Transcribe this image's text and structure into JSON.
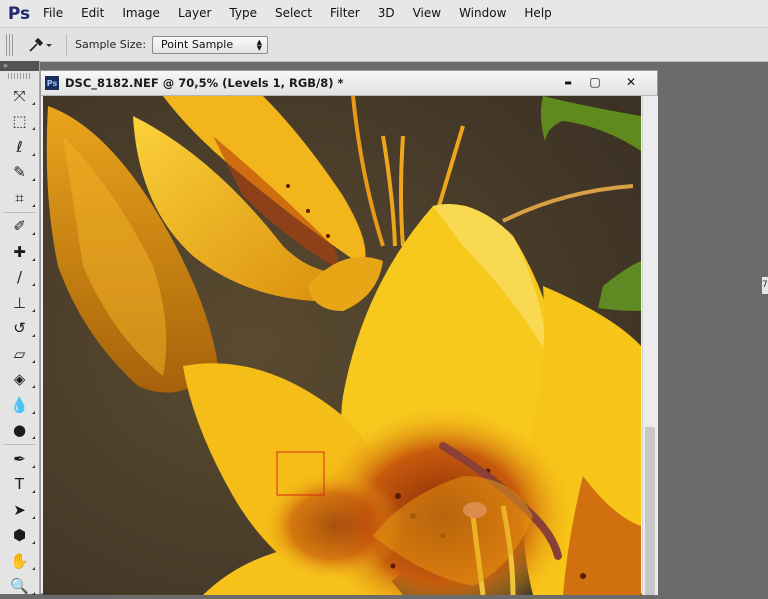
{
  "app": {
    "logo": "Ps"
  },
  "menu": [
    "File",
    "Edit",
    "Image",
    "Layer",
    "Type",
    "Select",
    "Filter",
    "3D",
    "View",
    "Window",
    "Help"
  ],
  "options_bar": {
    "sample_size_label": "Sample Size:",
    "sample_size_value": "Point Sample"
  },
  "tools_panel": {
    "header": "»",
    "tools": [
      {
        "name": "move-tool-icon",
        "glyph": "⤧"
      },
      {
        "name": "marquee-tool-icon",
        "glyph": "⬚"
      },
      {
        "name": "lasso-tool-icon",
        "glyph": "ℓ"
      },
      {
        "name": "quick-selection-tool-icon",
        "glyph": "✎"
      },
      {
        "name": "crop-tool-icon",
        "glyph": "⌗"
      },
      {
        "name": "eyedropper-tool-icon",
        "glyph": "✐"
      },
      {
        "name": "healing-brush-tool-icon",
        "glyph": "✚"
      },
      {
        "name": "brush-tool-icon",
        "glyph": "/"
      },
      {
        "name": "clone-stamp-tool-icon",
        "glyph": "⊥"
      },
      {
        "name": "history-brush-tool-icon",
        "glyph": "↺"
      },
      {
        "name": "eraser-tool-icon",
        "glyph": "▱"
      },
      {
        "name": "paint-bucket-tool-icon",
        "glyph": "◈"
      },
      {
        "name": "blur-tool-icon",
        "glyph": "💧"
      },
      {
        "name": "dodge-tool-icon",
        "glyph": "●"
      },
      {
        "name": "pen-tool-icon",
        "glyph": "✒"
      },
      {
        "name": "type-tool-icon",
        "glyph": "T"
      },
      {
        "name": "path-selection-tool-icon",
        "glyph": "➤"
      },
      {
        "name": "shape-tool-icon",
        "glyph": "⬢"
      },
      {
        "name": "hand-tool-icon",
        "glyph": "✋"
      },
      {
        "name": "zoom-tool-icon",
        "glyph": "🔍"
      }
    ]
  },
  "document": {
    "icon": "Ps",
    "title": "DSC_8182.NEF @ 70,5% (Levels 1, RGB/8) *",
    "minimize": "▬",
    "maximize": "▢",
    "close": "✕"
  },
  "colors": {
    "selection_box": "#d42a1a",
    "petal_yellow": "#f7c51a",
    "petal_orange": "#e8960f",
    "background_brown": "#4a3e2b"
  },
  "right_panel_stub": "7"
}
